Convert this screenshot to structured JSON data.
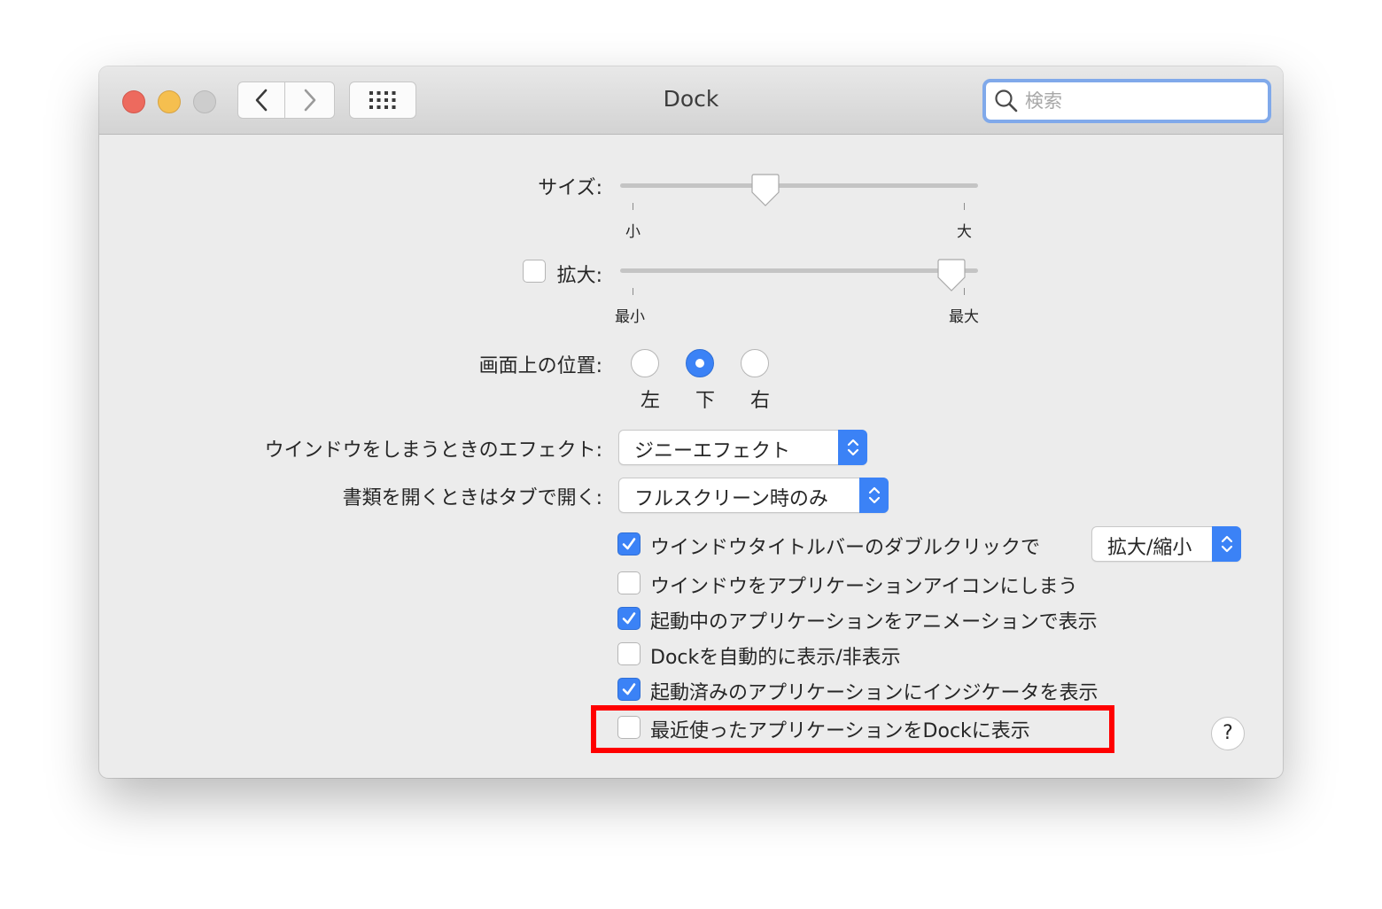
{
  "window": {
    "title": "Dock",
    "search_placeholder": "検索"
  },
  "size": {
    "label": "サイズ:",
    "min_label": "小",
    "max_label": "大",
    "value_fraction": 0.4
  },
  "magnification": {
    "label": "拡大:",
    "checked": false,
    "min_label": "最小",
    "max_label": "最大",
    "value_fraction": 0.96
  },
  "position": {
    "label": "画面上の位置:",
    "options": [
      "左",
      "下",
      "右"
    ],
    "selected": "下"
  },
  "minimize_effect": {
    "label": "ウインドウをしまうときのエフェクト:",
    "value": "ジニーエフェクト"
  },
  "prefer_tabs": {
    "label": "書類を開くときはタブで開く:",
    "value": "フルスクリーン時のみ"
  },
  "options": [
    {
      "label": "ウインドウタイトルバーのダブルクリックで",
      "checked": true,
      "popup_value": "拡大/縮小"
    },
    {
      "label": "ウインドウをアプリケーションアイコンにしまう",
      "checked": false
    },
    {
      "label": "起動中のアプリケーションをアニメーションで表示",
      "checked": true
    },
    {
      "label": "Dockを自動的に表示/非表示",
      "checked": false
    },
    {
      "label": "起動済みのアプリケーションにインジケータを表示",
      "checked": true
    },
    {
      "label": "最近使ったアプリケーションをDockに表示",
      "checked": false
    }
  ],
  "help_label": "?",
  "colors": {
    "accent": "#3b82f6",
    "close": "#ed6a5e",
    "minimize": "#f5bf4f",
    "zoom": "#cdcdcd",
    "highlight": "#ff0000"
  }
}
